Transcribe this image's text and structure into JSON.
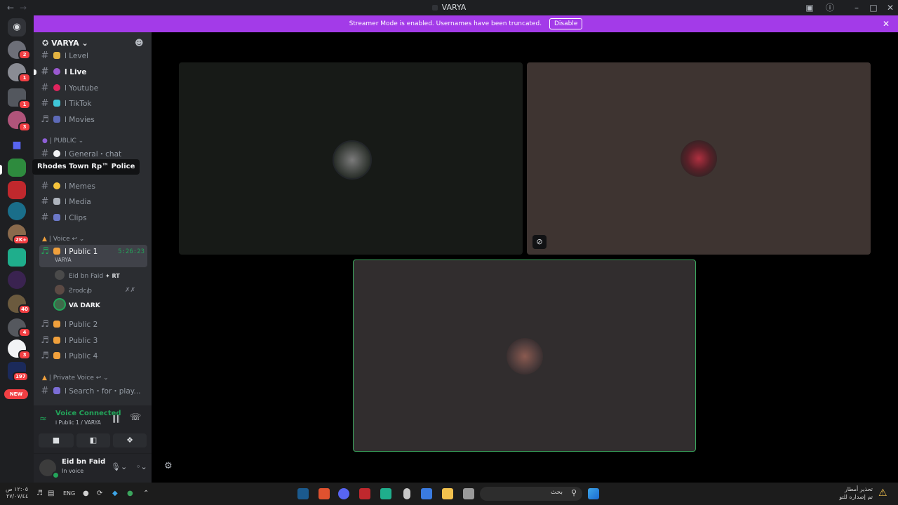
{
  "window": {
    "title": "VARYA"
  },
  "banner": {
    "text": "Streamer Mode is enabled. Usernames have been truncated.",
    "disable_label": "Disable"
  },
  "server": {
    "name": "VARYA"
  },
  "servers": {
    "badges": [
      "2",
      "1",
      "1",
      "3",
      "2K+",
      "40",
      "4",
      "3",
      "197"
    ],
    "new_label": "NEW"
  },
  "tooltip": {
    "text": "Rhodes Town Rp™ Police"
  },
  "channels": {
    "level": "ا Level",
    "live": "ا Live",
    "youtube": "ا Youtube",
    "tiktok": "ا TikTok",
    "movies": "ا Movies",
    "public_category": "| PUBLIC",
    "general": "ا General・chat",
    "memes": "ا Memes",
    "media": "ا Media",
    "clips": "ا Clips",
    "voice_category": "| Voice ↩",
    "public1": "ا Public 1",
    "public1_sub": "VARYA",
    "public1_timer": "5:26:23",
    "public2": "ا Public 2",
    "public3": "ا Public 3",
    "public4": "ا Public 4",
    "private_category": "| Private Voice ↩",
    "search": "ا Search・for・play..."
  },
  "voice_users": [
    {
      "name": "Eid bn Faid",
      "tag": "RT"
    },
    {
      "name": "Ƨrodcꞗ"
    },
    {
      "name": "VA DARK"
    }
  ],
  "voice_panel": {
    "status": "Voice Connected",
    "location": "ا Public 1 / VARYA"
  },
  "user_panel": {
    "name": "Eid bn Faid",
    "status": "In voice"
  },
  "taskbar": {
    "search_placeholder": "بحث",
    "lang": "ENG",
    "time": "١٢:٠٥ ص",
    "date": "٢٧/٠٧/٤٤",
    "notify_line1": "تحذير أمطار",
    "notify_line2": "تم إصداره للتو"
  },
  "colors": {
    "accent_banner": "#a33be8",
    "voice_green": "#23a55a",
    "speaking_border": "#3ba55d"
  }
}
